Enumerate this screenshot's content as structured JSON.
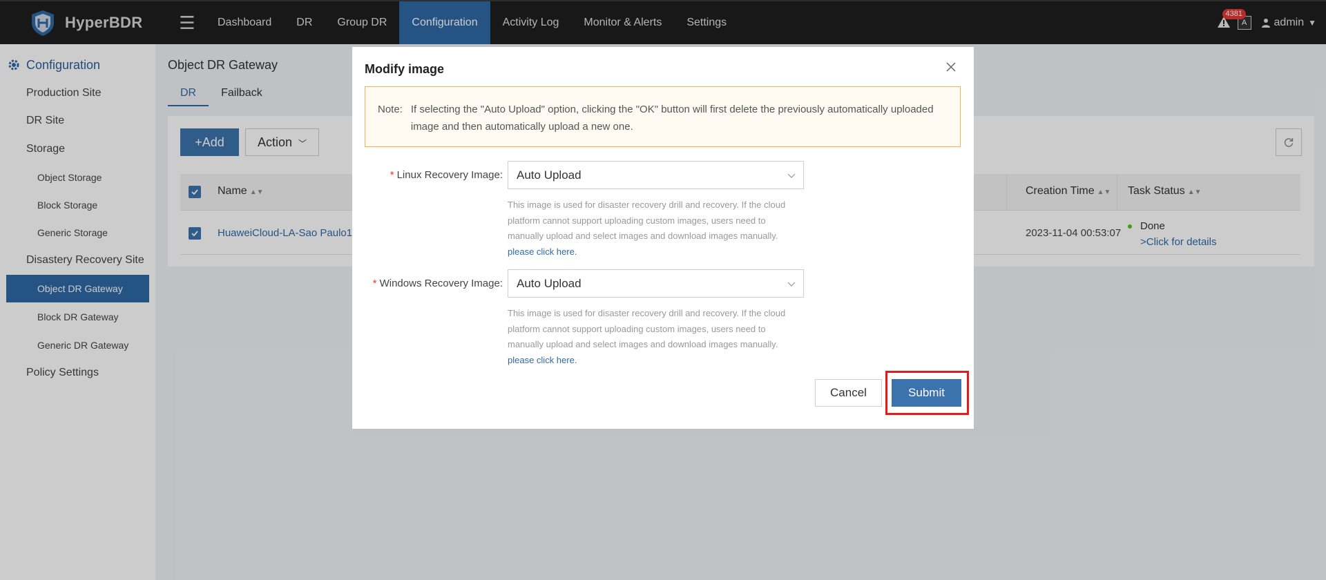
{
  "app": {
    "name": "HyperBDR",
    "alert_count": "4381",
    "lang_icon_text": "A",
    "user": "admin"
  },
  "nav": {
    "items": [
      "Dashboard",
      "DR",
      "Group DR",
      "Configuration",
      "Activity Log",
      "Monitor & Alerts",
      "Settings"
    ],
    "active": "Configuration"
  },
  "sidebar": {
    "header": "Configuration",
    "items": [
      "Production Site",
      "DR Site",
      "Storage",
      "Object Storage",
      "Block Storage",
      "Generic Storage",
      "Disastery Recovery Site",
      "Object DR Gateway",
      "Block DR Gateway",
      "Generic DR Gateway",
      "Policy Settings"
    ],
    "active": "Object DR Gateway"
  },
  "main": {
    "title": "Object DR Gateway",
    "tabs": [
      "DR",
      "Failback"
    ],
    "active_tab": "DR",
    "add_label": "+Add",
    "action_label": "Action",
    "table": {
      "columns": [
        "Name",
        "Creation Time",
        "Task Status"
      ],
      "rows": [
        {
          "name": "HuaweiCloud-LA-Sao Paulo1",
          "creation_time": "2023-11-04 00:53:07",
          "status": "Done",
          "status_link": ">Click for details"
        }
      ]
    }
  },
  "modal": {
    "title": "Modify image",
    "note_label": "Note:",
    "note_text": "If selecting the \"Auto Upload\" option, clicking the \"OK\" button will first delete the previously automatically uploaded image and then automatically upload a new one.",
    "linux_label": "Linux Recovery Image:",
    "linux_value": "Auto Upload",
    "windows_label": "Windows Recovery Image:",
    "windows_value": "Auto Upload",
    "help_text": "This image is used for disaster recovery drill and recovery. If the cloud platform cannot support uploading custom images, users need to manually upload and select images and download images manually.",
    "help_link": "please click here.",
    "cancel_label": "Cancel",
    "submit_label": "Submit"
  },
  "colors": {
    "accent": "#2f6aa6",
    "highlight": "#e21b1b",
    "note_border": "#f5b253"
  }
}
